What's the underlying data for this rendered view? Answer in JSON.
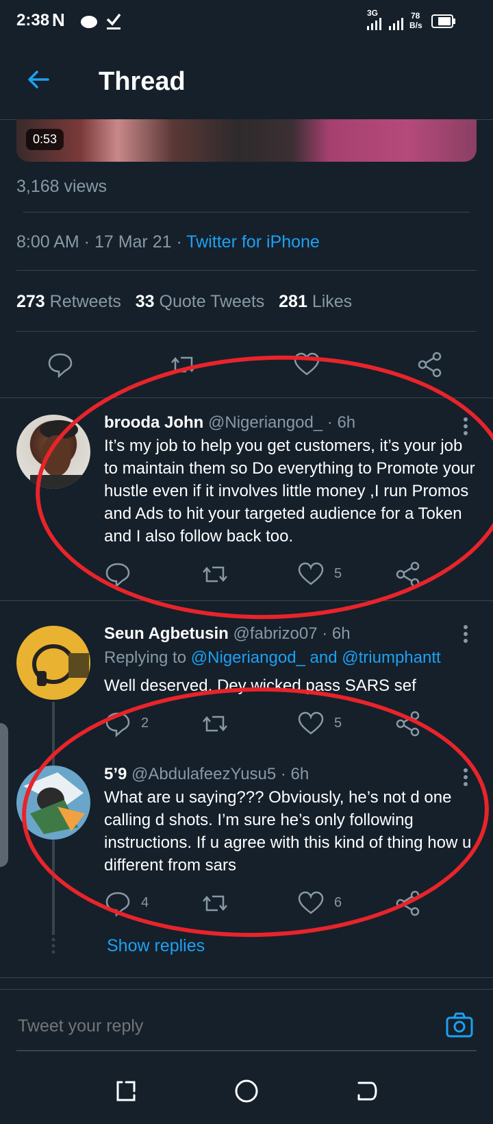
{
  "status_bar": {
    "time": "2:38",
    "network": "3G",
    "speed_top": "78",
    "speed_bottom": "B/s"
  },
  "header": {
    "title": "Thread"
  },
  "video": {
    "duration": "0:53"
  },
  "main_tweet": {
    "views": "3,168 views",
    "timestamp": "8:00 AM · 17 Mar 21 · ",
    "source": "Twitter for iPhone",
    "retweets_count": "273",
    "retweets_label": "Retweets",
    "quotes_count": "33",
    "quotes_label": "Quote Tweets",
    "likes_count": "281",
    "likes_label": "Likes"
  },
  "replies": [
    {
      "name": "brooda John",
      "handle": "@Nigeriangod_ · 6h",
      "text": "It’s my job to help you get customers, it’s your job to maintain them so Do everything to Promote your hustle even if it involves little money ,I run Promos and Ads to hit your targeted audience for a Token and I also follow back too.",
      "likes": "5"
    },
    {
      "name": "Seun Agbetusin",
      "handle": "@fabrizo07 · 6h",
      "replying_prefix": "Replying to ",
      "replying_to": "@Nigeriangod_ and @triumphantt",
      "text": "Well deserved. Dey wicked pass SARS sef",
      "replies": "2",
      "likes": "5"
    },
    {
      "name": "5’9",
      "handle": "@AbdulafeezYusu5 · 6h",
      "text": "What are u saying??? Obviously, he’s not d one calling d shots. I’m sure he’s only following instructions. If u agree with this kind of thing how u different from sars",
      "replies": "4",
      "likes": "6"
    }
  ],
  "show_replies": "Show replies",
  "compose": {
    "placeholder": "Tweet your reply"
  },
  "colors": {
    "background": "#15202b",
    "accent": "#1da1f2",
    "secondary_text": "#8899a6",
    "annotation": "#e8242a"
  },
  "icons": [
    "back-arrow-icon",
    "reply-icon",
    "retweet-icon",
    "like-icon",
    "share-icon",
    "more-icon",
    "camera-icon",
    "recent-apps-icon",
    "home-icon",
    "back-nav-icon"
  ]
}
